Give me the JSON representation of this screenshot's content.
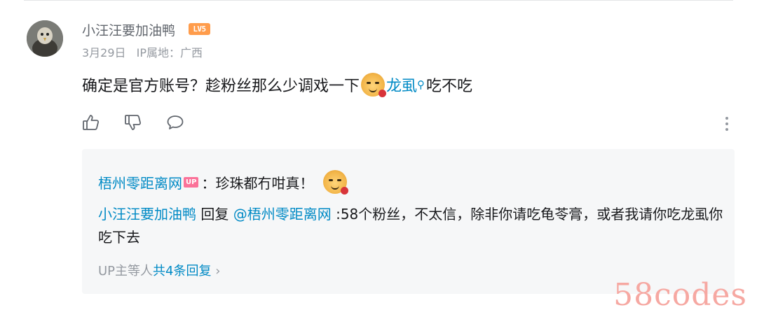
{
  "comment": {
    "username": "小汪汪要加油鸭",
    "level_badge": "LV5",
    "date": "3月29日",
    "ip_location": "IP属地：广西",
    "text_before": "确定是官方账号？趁粉丝那么少调戏一下",
    "keyword_link": "龙虱",
    "text_after": "吃不吃",
    "icons": [
      "like-icon",
      "dislike-icon",
      "reply-icon",
      "more-icon"
    ]
  },
  "replies": {
    "reply1": {
      "username": "梧州零距离网",
      "up_badge": "UP",
      "text": "：珍珠都冇咁真！"
    },
    "reply2": {
      "username": "小汪汪要加油鸭",
      "reply_word": " 回复 ",
      "mention": "@梧州零距离网",
      "text": " :58个粉丝，不太信，除非你请吃龟苓膏，或者我请你吃龙虱你吃下去"
    },
    "footer_prefix": "UP主等人",
    "footer_count": "共4条回复",
    "footer_arrow": "›"
  },
  "watermark": "58codes",
  "colors": {
    "link": "#008ac5",
    "secondary_text": "#9499a0",
    "level_badge": "#ff9c4b",
    "up_badge": "#fb7299",
    "reply_bg": "#f6f7f8"
  }
}
